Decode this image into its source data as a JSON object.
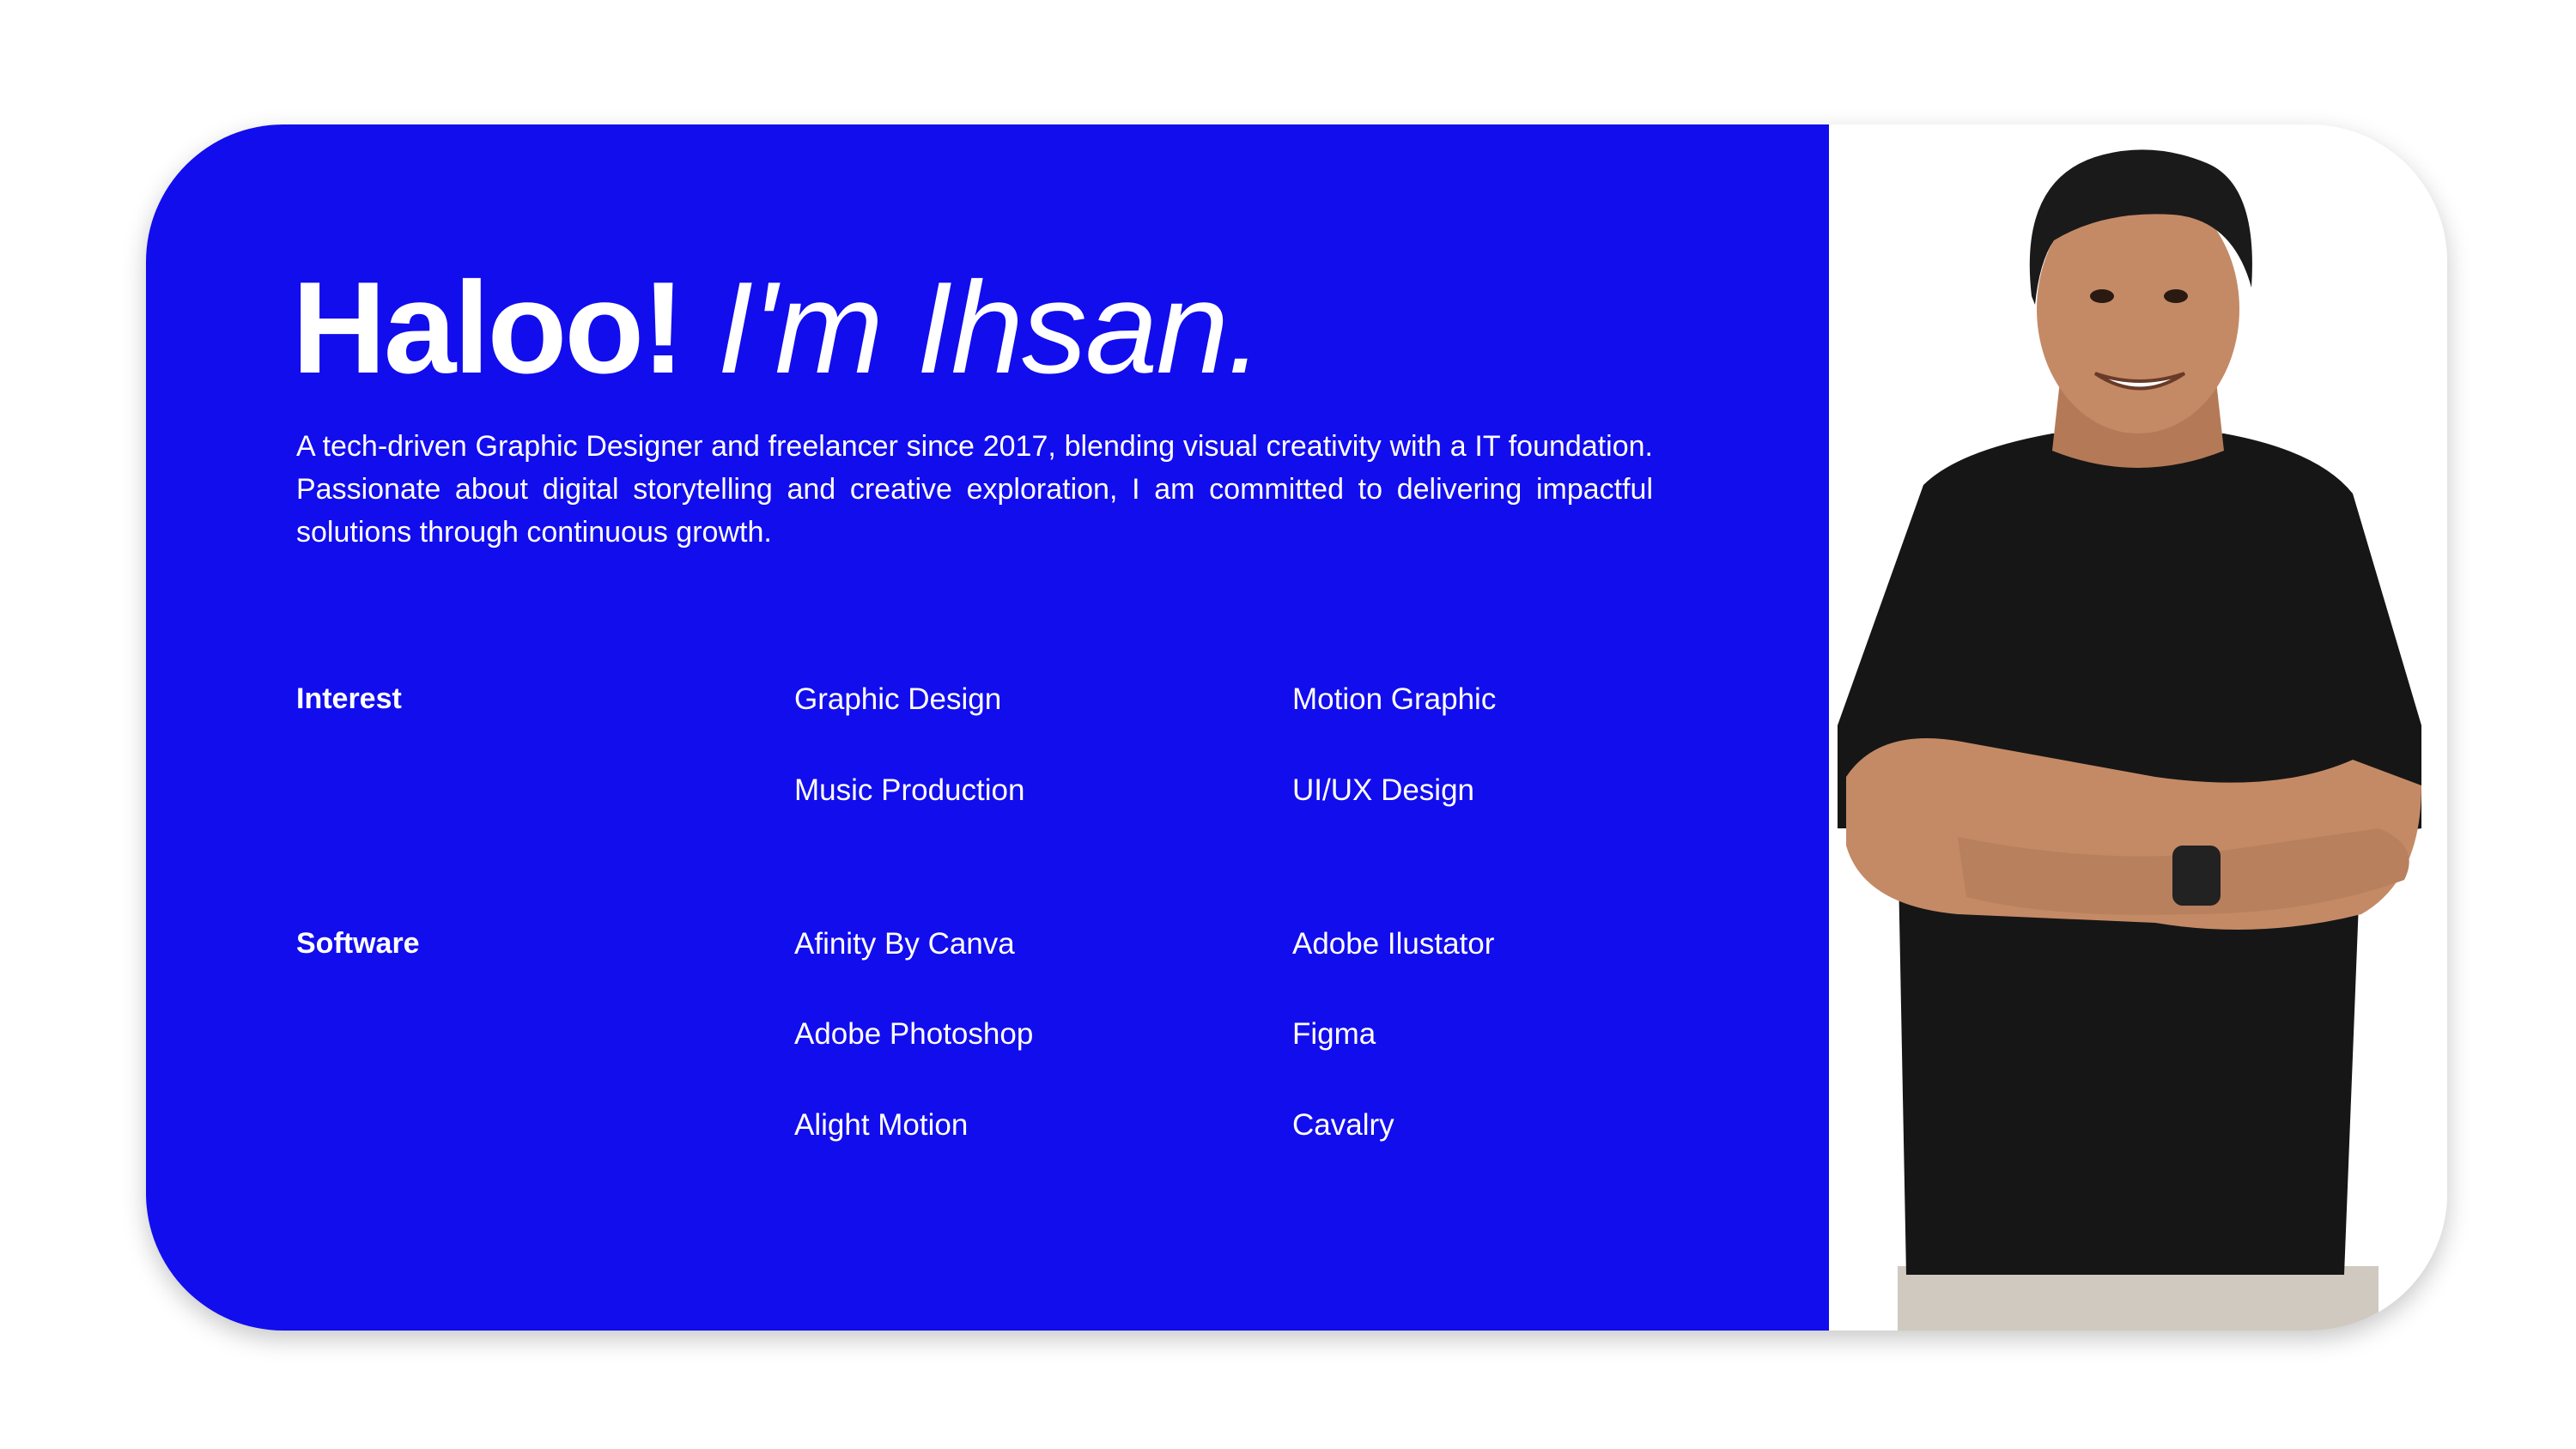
{
  "hero": {
    "greeting": "Haloo!",
    "name": " I'm Ihsan.",
    "bio": "A tech-driven Graphic Designer and freelancer since 2017, blending visual creativity with a IT foundation. Passionate about digital storytelling and creative exploration, I am committed to delivering impactful solutions through continuous growth."
  },
  "interest": {
    "label": "Interest",
    "items": [
      "Graphic Design",
      "Motion Graphic",
      "Music Production",
      "UI/UX Design"
    ]
  },
  "software": {
    "label": "Software",
    "items": [
      "Afinity By Canva",
      "Adobe Ilustator",
      "Adobe Photoshop",
      "Figma",
      "Alight Motion",
      "Cavalry"
    ]
  },
  "colors": {
    "accent": "#120ded",
    "shirt": "#161616",
    "skin": "#c48a66",
    "hair": "#1a1a1a"
  },
  "icons": {
    "portrait": "person-portrait-icon"
  }
}
